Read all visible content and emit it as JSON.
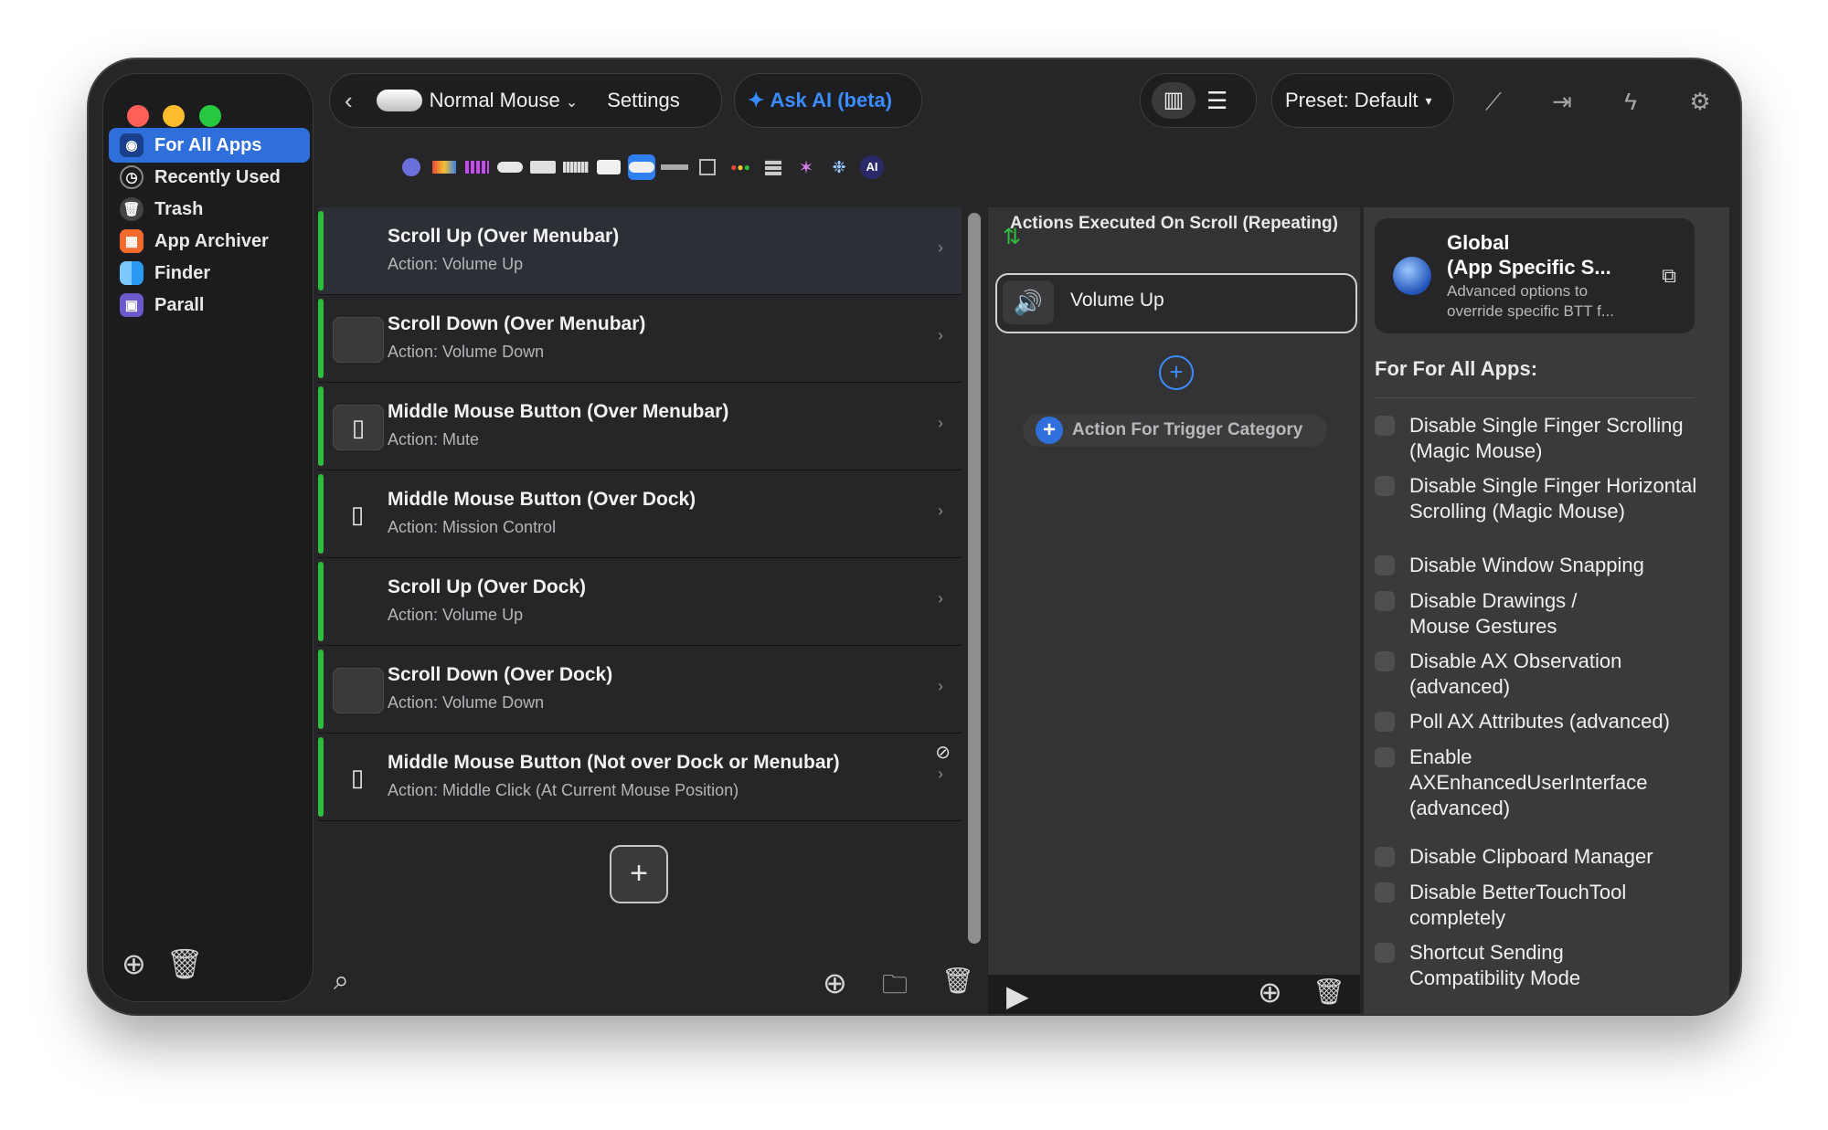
{
  "sidebar": {
    "items": [
      {
        "label": "For All Apps",
        "icon": "globe-icon",
        "color": "#2f6fdc"
      },
      {
        "label": "Recently Used",
        "icon": "clock-icon",
        "color": "#555555"
      },
      {
        "label": "Trash",
        "icon": "trash-icon",
        "color": "#555555"
      },
      {
        "label": "App Archiver",
        "icon": "app-archiver-icon",
        "color": "#f26a2e"
      },
      {
        "label": "Finder",
        "icon": "finder-icon",
        "color": "#2b9af3"
      },
      {
        "label": "Parall",
        "icon": "parall-icon",
        "color": "#6a5acd"
      }
    ]
  },
  "toolbar": {
    "device_label": "Normal Mouse",
    "settings_label": "Settings",
    "ask_ai_label": "Ask AI (beta)",
    "preset_label": "Preset: Default"
  },
  "triggers": [
    {
      "title": "Scroll Up (Over Menubar)",
      "action": "Action: Volume Up",
      "icon": "none"
    },
    {
      "title": "Scroll Down (Over Menubar)",
      "action": "Action: Volume Down",
      "icon": "blank-box-icon"
    },
    {
      "title": "Middle Mouse Button (Over Menubar)",
      "action": "Action: Mute",
      "icon": "mouse-icon"
    },
    {
      "title": "Middle Mouse Button (Over Dock)",
      "action": "Action: Mission Control",
      "icon": "mouse-icon"
    },
    {
      "title": "Scroll Up (Over Dock)",
      "action": "Action: Volume Up",
      "icon": "none"
    },
    {
      "title": "Scroll Down (Over Dock)",
      "action": "Action: Volume Down",
      "icon": "blank-box-icon"
    },
    {
      "title": "Middle Mouse Button (Not over Dock or Menubar)",
      "action": "Action: Middle Click (At Current Mouse Position)",
      "icon": "mouse-icon"
    }
  ],
  "actions_panel": {
    "header": "Actions Executed On Scroll (Repeating)",
    "action_label": "Volume Up",
    "trigger_category_label": "Action For Trigger Category"
  },
  "global_panel": {
    "title_line1": "Global",
    "title_line2": "(App Specific S...",
    "desc_line1": "Advanced options to",
    "desc_line2": "override specific BTT f...",
    "section_title": "For For All Apps:",
    "options": [
      "Disable Single Finger Scrolling (Magic Mouse)",
      "Disable Single Finger Horizontal Scrolling (Magic Mouse)",
      "Disable Window Snapping",
      "Disable Drawings / Mouse Gestures",
      "Disable AX Observation (advanced)",
      "Poll AX Attributes (advanced)",
      "Enable AXEnhancedUserInterface (advanced)",
      "Disable Clipboard Manager",
      "Disable BetterTouchTool completely",
      "Shortcut Sending Compatibility Mode"
    ]
  },
  "colors": {
    "accent": "#2f6fdc",
    "ai_blue": "#3b8cff",
    "trigger_bar": "#2dbe3c"
  }
}
